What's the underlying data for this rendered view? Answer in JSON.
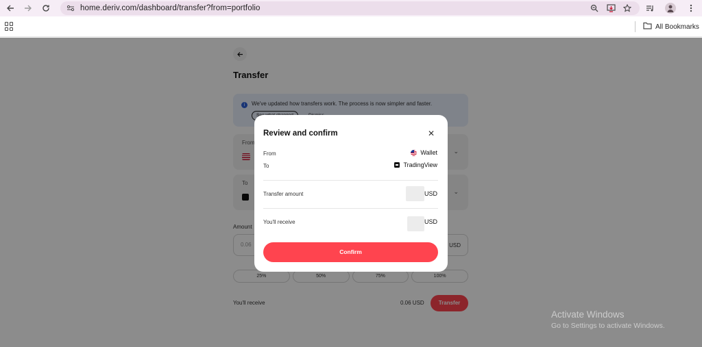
{
  "browser": {
    "url": "home.deriv.com/dashboard/transfer?from=portfolio",
    "all_bookmarks": "All Bookmarks"
  },
  "page": {
    "title": "Transfer",
    "banner_text": "We've updated how transfers work. The process is now simpler and faster.",
    "banner_button": "See what changed",
    "banner_dismiss": "Dismiss",
    "from_label": "From",
    "to_label": "To",
    "amount_label": "Amount",
    "amount_value": "0.06",
    "amount_currency": "USD",
    "percentages": [
      "25%",
      "50%",
      "75%",
      "100%"
    ],
    "receive_label": "You'll receive",
    "receive_value": "0.06 USD",
    "transfer_button": "Transfer"
  },
  "modal": {
    "title": "Review and confirm",
    "from_label": "From",
    "from_value": "Wallet",
    "to_label": "To",
    "to_value": "TradingView",
    "transfer_amount_label": "Transfer amount",
    "transfer_amount_currency": "USD",
    "receive_label": "You'll receive",
    "receive_currency": "USD",
    "confirm_button": "Confirm"
  },
  "watermark": {
    "title": "Activate Windows",
    "subtitle": "Go to Settings to activate Windows."
  }
}
